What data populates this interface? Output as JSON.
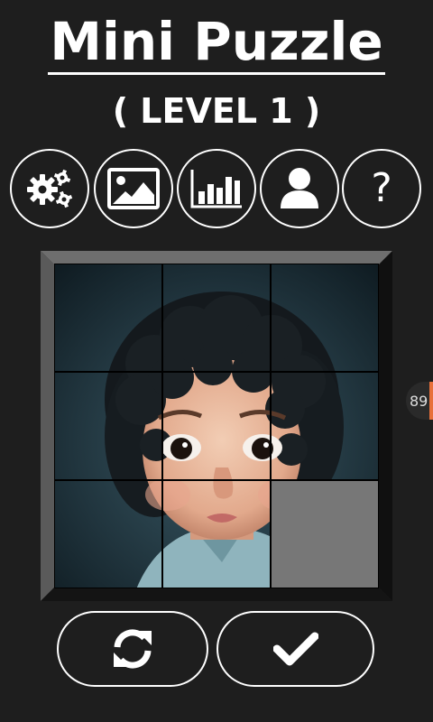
{
  "header": {
    "title": "Mini Puzzle",
    "level": "( LEVEL 1 )"
  },
  "toolbar": {
    "buttons": [
      {
        "icon": "gears-icon"
      },
      {
        "icon": "image-icon"
      },
      {
        "icon": "stats-chart-icon"
      },
      {
        "icon": "user-icon"
      },
      {
        "icon": "help-icon",
        "label": "?"
      }
    ]
  },
  "puzzle": {
    "grid": "3x3",
    "empty_slot": "bottom-right",
    "frame_colors": {
      "top": "#6e6e6e",
      "left": "#5a5a5a",
      "right": "#101010",
      "bottom": "#141414"
    },
    "empty_tile_color": "#777777"
  },
  "side_badge": {
    "value": "89",
    "accent": "#e8703a"
  },
  "actions": {
    "shuffle_icon": "refresh-icon",
    "confirm_icon": "check-icon"
  }
}
